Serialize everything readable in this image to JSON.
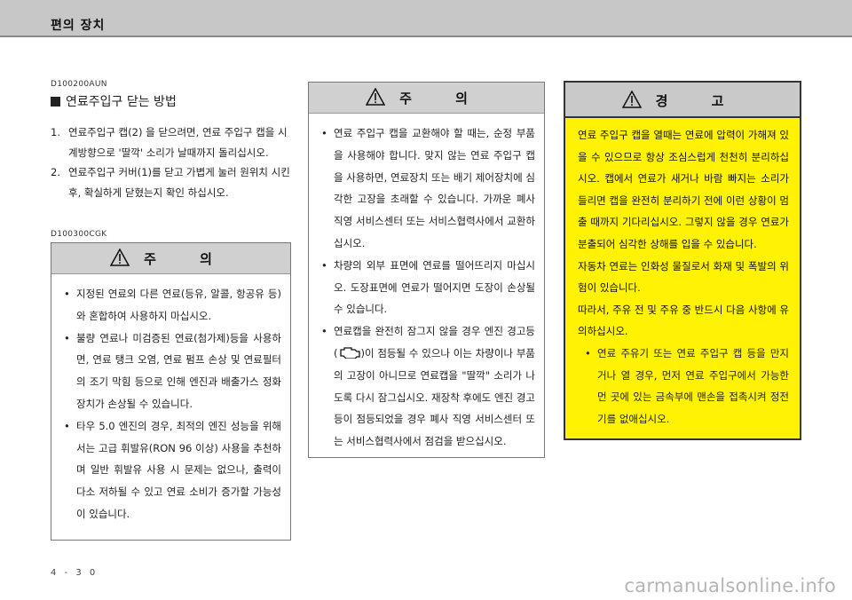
{
  "header": {
    "title": "편의 장치"
  },
  "section1": {
    "code": "D100200AUN",
    "title": "연료주입구 닫는 방법",
    "steps": [
      {
        "num": "1.",
        "text": "연료주입구 캡(2) 을 닫으려면, 연료 주입구 캡을 시계방향으로 '딸깍' 소리가 날때까지 돌리십시오."
      },
      {
        "num": "2.",
        "text": "연료주입구 커버(1)를 닫고 가볍게 눌러 원위치 시킨 후, 확실하게 닫혔는지 확인 하십시오."
      }
    ]
  },
  "caution1": {
    "code": "D100300CGK",
    "heading": "주 의",
    "items": [
      "지정된 연료외 다른 연료(등유, 알콜, 항공유 등)와 혼합하여 사용하지 마십시오.",
      "불량 연료나 미검증된 연료(첨가제)등을 사용하면, 연료 탱크 오염, 연료 펌프 손상 및 연료필터의 조기 막힘 등으로 인해 엔진과 배출가스 정화장치가 손상될 수 있습니다.",
      "타우 5.0 엔진의 경우, 최적의 엔진 성능을 위해서는 고급 휘발유(RON 96 이상) 사용을 추천하며 일반 휘발유 사용 시 문제는 없으나, 출력이 다소 저하될 수 있고 연료 소비가 증가할 가능성이 있습니다."
    ]
  },
  "caution2": {
    "heading": "주 의",
    "item1": "연료 주입구 캡을 교환해야 할 때는, 순정 부품을 사용해야 합니다. 맞지 않는 연료 주입구 캡을 사용하면, 연료장치 또는 배기 제어장치에 심각한 고장을 초래할 수 있습니다. 가까운 폐사 직영 서비스센터 또는 서비스협력사에서 교환하십시오.",
    "item2": "차량의 외부 표면에 연료를 떨어뜨리지 마십시오. 도장표면에 연료가 떨어지면 도장이 손상될 수 있습니다.",
    "item3_before": "연료캡을 완전히 잠그지 않을 경우 엔진 경고등(",
    "item3_after": ")이 점등될 수 있으나 이는 차량이나 부품의 고장이 아니므로 연료캡을 \"딸깍\" 소리가 나도록 다시 잠그십시오. 재장착 후에도 엔진 경고등이 점등되었을 경우 폐사 직영 서비스센터 또는 서비스협력사에서 점검을 받으십시오.",
    "engine_icon": "engine-check-icon"
  },
  "warning": {
    "heading": "경 고",
    "text": "연료 주입구 캡을 열때는 연료에 압력이 가해져 있을 수 있으므로 항상 조심스럽게 천천히 분리하십시오. 캡에서 연료가 새거나 바람 빠지는 소리가 들리면 캡을 완전히 분리하기 전에 이런 상황이 멈출 때까지 기다리십시오. 그렇지 않을 경우 연료가 분출되어 심각한 상해를 입을 수 있습니다.",
    "text2": "자동차 연료는 인화성 물질로서 화재 및 폭발의 위험이 있습니다.",
    "text3": "따라서, 주유 전 및 주유 중 반드시 다음 사항에 유의하십시오.",
    "bullet": "연료 주유기 또는 연료 주입구 캡 등을 만지거나 열 경우, 먼저 연료 주입구에서 가능한 먼 곳에 있는 금속부에 맨손을 접촉시켜 정전기를 없애십시오."
  },
  "footer": {
    "page": "4 - 3 0",
    "watermark": "carmanualsonline.info"
  },
  "colors": {
    "header_bg": "#c7c7c7",
    "warning_bg": "#fff203",
    "box_head_bg": "#d0d0d0"
  }
}
